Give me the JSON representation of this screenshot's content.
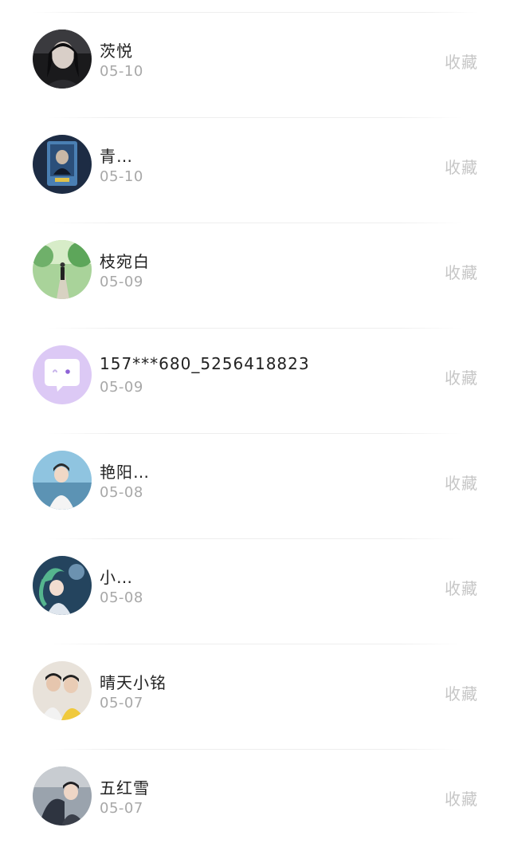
{
  "contacts": [
    {
      "name": "茨悦",
      "date": "05-10",
      "action": "收藏",
      "avatar_icon": "photo-avatar-icon"
    },
    {
      "name": "青…",
      "date": "05-10",
      "action": "收藏",
      "avatar_icon": "photo-avatar-icon"
    },
    {
      "name": "枝宛白",
      "date": "05-09",
      "action": "收藏",
      "avatar_icon": "photo-avatar-icon"
    },
    {
      "name": "157***680_5256418823",
      "date": "05-09",
      "action": "收藏",
      "avatar_icon": "chat-bubble-icon"
    },
    {
      "name": "艳阳…",
      "date": "05-08",
      "action": "收藏",
      "avatar_icon": "photo-avatar-icon"
    },
    {
      "name": "小…",
      "date": "05-08",
      "action": "收藏",
      "avatar_icon": "photo-avatar-icon"
    },
    {
      "name": "晴天小铭",
      "date": "05-07",
      "action": "收藏",
      "avatar_icon": "photo-avatar-icon"
    },
    {
      "name": "五红雪",
      "date": "05-07",
      "action": "收藏",
      "avatar_icon": "photo-avatar-icon"
    }
  ],
  "colors": {
    "name_text": "#222222",
    "date_text": "#a8a8a8",
    "action_text": "#c6c6c6",
    "default_avatar_bg": "#dcc9f5",
    "default_avatar_accent": "#8e63d6"
  }
}
